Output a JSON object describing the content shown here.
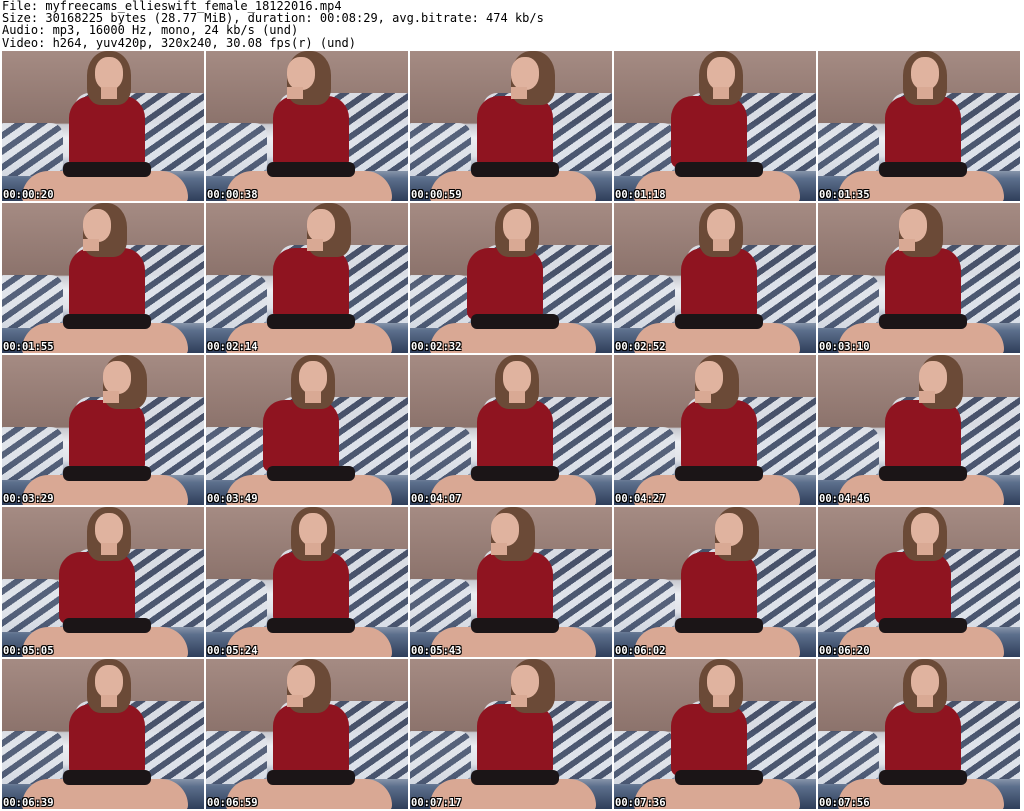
{
  "header": {
    "file": "File: myfreecams_ellieswift_female_18122016.mp4",
    "size": "Size: 30168225 bytes (28.77 MiB), duration: 00:08:29, avg.bitrate: 474 kb/s",
    "audio": "Audio: mp3, 16000 Hz, mono, 24 kb/s (und)",
    "video": "Video: h264, yuv420p, 320x240, 30.08 fps(r) (und)"
  },
  "thumbnails": [
    {
      "timestamp": "00:00:20"
    },
    {
      "timestamp": "00:00:38"
    },
    {
      "timestamp": "00:00:59"
    },
    {
      "timestamp": "00:01:18"
    },
    {
      "timestamp": "00:01:35"
    },
    {
      "timestamp": "00:01:55"
    },
    {
      "timestamp": "00:02:14"
    },
    {
      "timestamp": "00:02:32"
    },
    {
      "timestamp": "00:02:52"
    },
    {
      "timestamp": "00:03:10"
    },
    {
      "timestamp": "00:03:29"
    },
    {
      "timestamp": "00:03:49"
    },
    {
      "timestamp": "00:04:07"
    },
    {
      "timestamp": "00:04:27"
    },
    {
      "timestamp": "00:04:46"
    },
    {
      "timestamp": "00:05:05"
    },
    {
      "timestamp": "00:05:24"
    },
    {
      "timestamp": "00:05:43"
    },
    {
      "timestamp": "00:06:02"
    },
    {
      "timestamp": "00:06:20"
    },
    {
      "timestamp": "00:06:39"
    },
    {
      "timestamp": "00:06:59"
    },
    {
      "timestamp": "00:07:17"
    },
    {
      "timestamp": "00:07:36"
    },
    {
      "timestamp": "00:07:56"
    }
  ]
}
